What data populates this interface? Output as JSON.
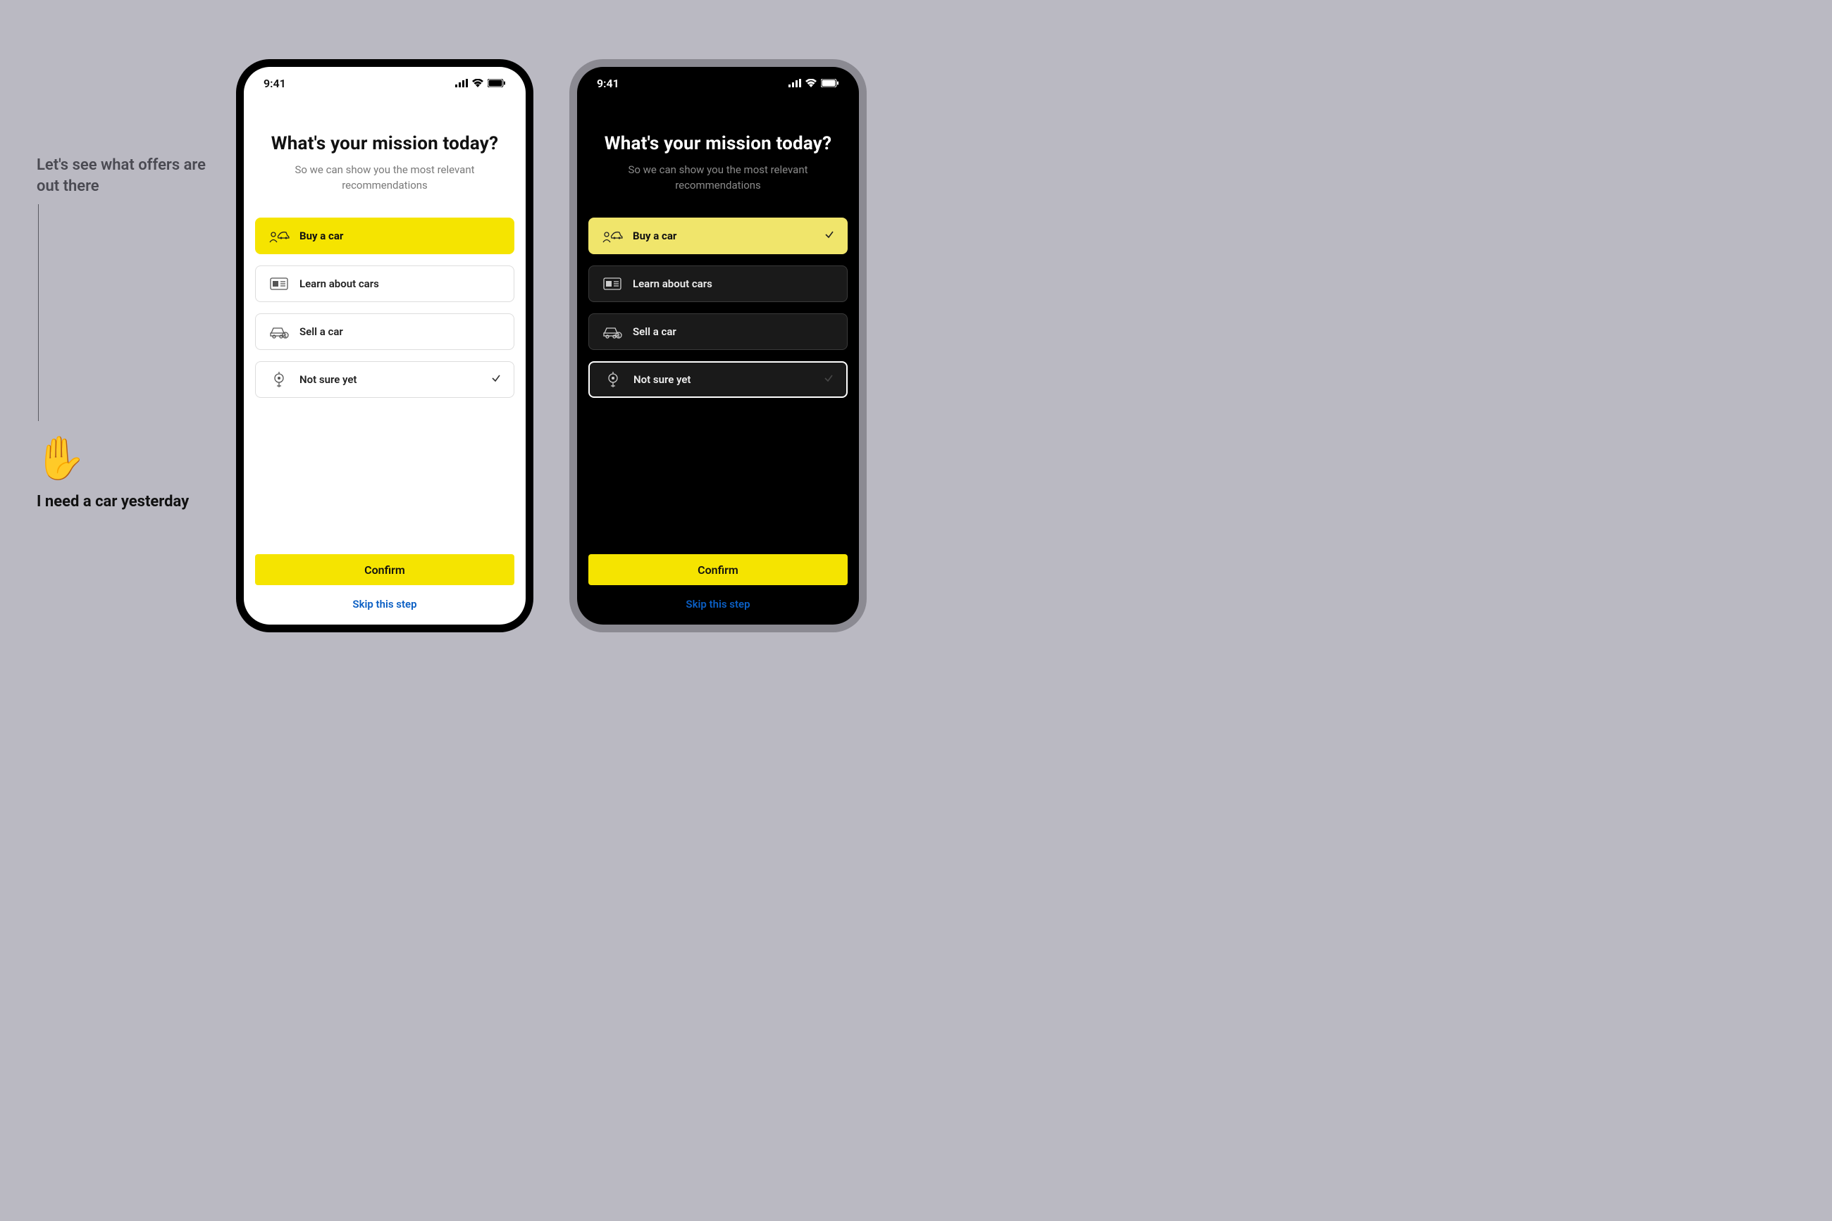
{
  "sidebar": {
    "heading": "Let's see what offers are out there",
    "emoji": "✋",
    "caption": "I need a car yesterday"
  },
  "status": {
    "time": "9:41"
  },
  "screens": {
    "title": "What's your mission today?",
    "subtitle": "So we can show you the most relevant recommendations",
    "confirm": "Confirm",
    "skip": "Skip this step"
  },
  "options": [
    {
      "label": "Buy a car"
    },
    {
      "label": "Learn about cars"
    },
    {
      "label": "Sell a car"
    },
    {
      "label": "Not sure yet"
    }
  ]
}
